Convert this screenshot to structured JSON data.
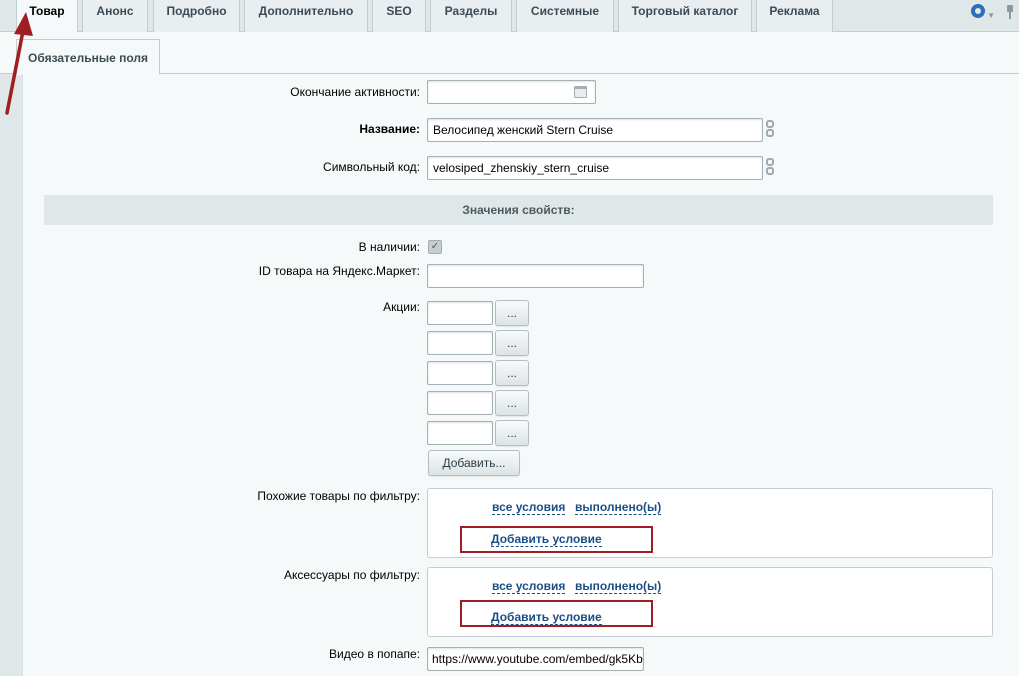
{
  "tabs": [
    {
      "label": "Товар",
      "active": true
    },
    {
      "label": "Анонс"
    },
    {
      "label": "Подробно"
    },
    {
      "label": "Дополнительно"
    },
    {
      "label": "SEO"
    },
    {
      "label": "Разделы"
    },
    {
      "label": "Системные"
    },
    {
      "label": "Торговый каталог"
    },
    {
      "label": "Реклама"
    }
  ],
  "tools": {
    "settings_icon": "gear-icon",
    "pin_icon": "pin-icon"
  },
  "subtab": {
    "label": "Обязательные поля"
  },
  "fields": {
    "end_activity": {
      "label": "Окончание активности:",
      "value": ""
    },
    "name": {
      "label": "Название:",
      "value": "Велосипед женский Stern Cruise"
    },
    "code": {
      "label": "Символьный код:",
      "value": "velosiped_zhenskiy_stern_cruise"
    }
  },
  "section_title": "Значения свойств:",
  "properties": {
    "in_stock": {
      "label": "В наличии:",
      "checked": true,
      "check_mark": "✓"
    },
    "yandex_id": {
      "label": "ID товара на Яндекс.Маркет:",
      "value": ""
    },
    "promos": {
      "label": "Акции:",
      "rows": [
        "",
        "",
        "",
        "",
        ""
      ],
      "picker_label": "...",
      "add_label": "Добавить..."
    },
    "similar_filter": {
      "label": "Похожие товары по фильтру:",
      "link_all": "все условия",
      "link_done": "выполнено(ы)",
      "add_condition": "Добавить условие"
    },
    "accessories_filter": {
      "label": "Аксессуары по фильтру:",
      "link_all": "все условия",
      "link_done": "выполнено(ы)",
      "add_condition": "Добавить условие"
    },
    "video_popup": {
      "label": "Видео в попапе:",
      "value": "https://www.youtube.com/embed/gk5Kb"
    }
  },
  "colors": {
    "annotation_red": "#a01e22",
    "link_blue": "#1a4f86",
    "accent_blue": "#2c6fbb"
  }
}
